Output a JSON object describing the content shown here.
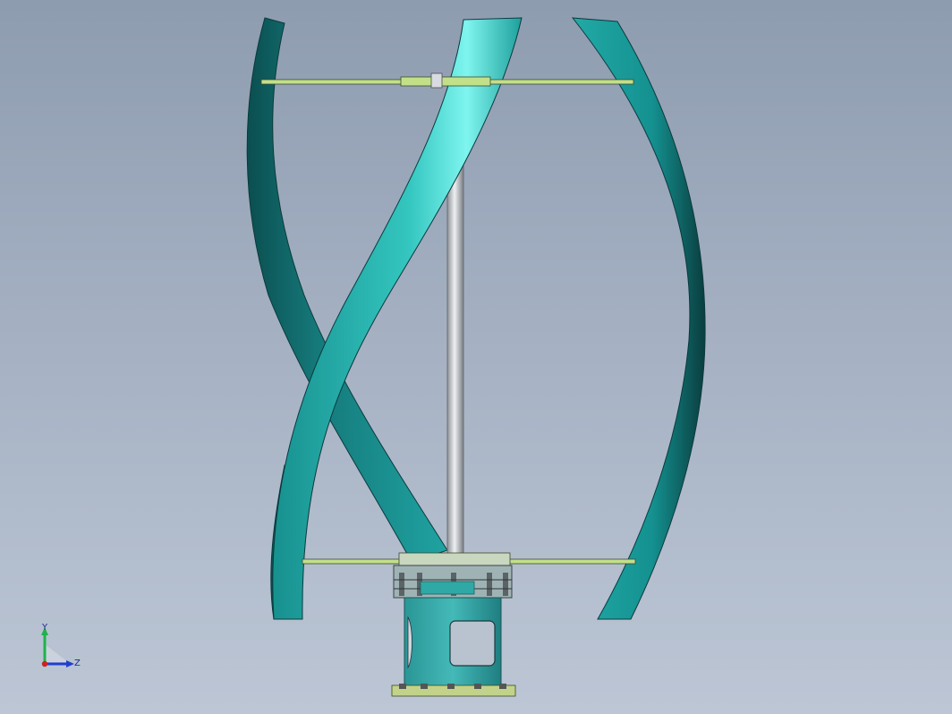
{
  "viewport": {
    "background": "#a4b0c2"
  },
  "model": {
    "blade_color": "#1a9c9c",
    "blade_shadow": "#0b4e50",
    "blade_highlight": "#7ff5ef",
    "shaft_color": "#c4c8cc",
    "arm_color": "#c2e08a",
    "base_color": "#2fa3a3"
  },
  "triad": {
    "y_label": "Y",
    "z_label": "Z",
    "y_color": "#22b14c",
    "z_color": "#1f3fd0",
    "origin_color": "#d0201d"
  }
}
